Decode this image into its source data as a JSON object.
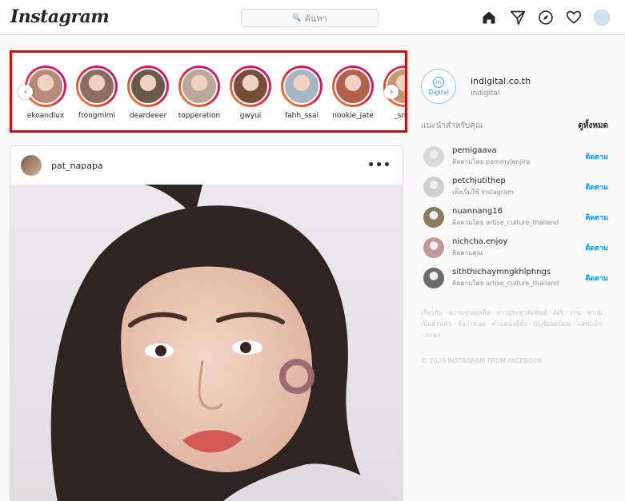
{
  "header": {
    "logo": "Instagram",
    "search_placeholder": "ค้นหา"
  },
  "stories": [
    {
      "name": "ekoandlux",
      "color": "#b88a78"
    },
    {
      "name": "frongmimi",
      "color": "#8a6d63"
    },
    {
      "name": "deardeeer",
      "color": "#6b5a4c"
    },
    {
      "name": "topperation",
      "color": "#b8a79a"
    },
    {
      "name": "gwyui",
      "color": "#7a4b3a"
    },
    {
      "name": "fahh_ssai",
      "color": "#a7b6c4"
    },
    {
      "name": "nookie_jate",
      "color": "#b1604c"
    },
    {
      "name": "_snpc",
      "color": "#c89a72"
    }
  ],
  "post": {
    "username": "pat_napapa",
    "more_icon": "more-icon"
  },
  "sidebar": {
    "username": "indigital.co.th",
    "name": "Indigital",
    "logo_mark": "in",
    "logo_text": "Digital",
    "suggestions_title": "แนะนำสำหรับคุณ",
    "see_all": "ดูทั้งหมด",
    "suggestions": [
      {
        "username": "pemigaava",
        "sub": "ติดตามโดย pammyjenjira",
        "follow": "ติดตาม",
        "color": "#d8d8d8"
      },
      {
        "username": "petchjutithep",
        "sub": "เพิ่งเริ่มใช้ Instagram",
        "follow": "ติดตาม",
        "color": "#cfcfcf"
      },
      {
        "username": "nuannang16",
        "sub": "ติดตามโดย artise_culture_thailand",
        "follow": "ติดตาม",
        "color": "#8b7a5b"
      },
      {
        "username": "nichcha.enjoy",
        "sub": "ติดตามคุณ",
        "follow": "ติดตาม",
        "color": "#c09a98"
      },
      {
        "username": "siththichaymngkhlphngs",
        "sub": "ติดตามโดย artise_culture_thailand",
        "follow": "ติดตาม",
        "color": "#6c6c6c"
      }
    ],
    "footer_links": "เกี่ยวกับ · ความช่วยเหลือ · ข่าวประชาสัมพันธ์ · API · งาน · ความเป็นส่วนตัว · ข้อกำหนด · ตำแหน่งที่ตั้ง · บัญชียอดนิยม · แฮชแท็ก · ภาษา",
    "copyright": "© 2020 INSTAGRAM FROM FACEBOOK"
  }
}
